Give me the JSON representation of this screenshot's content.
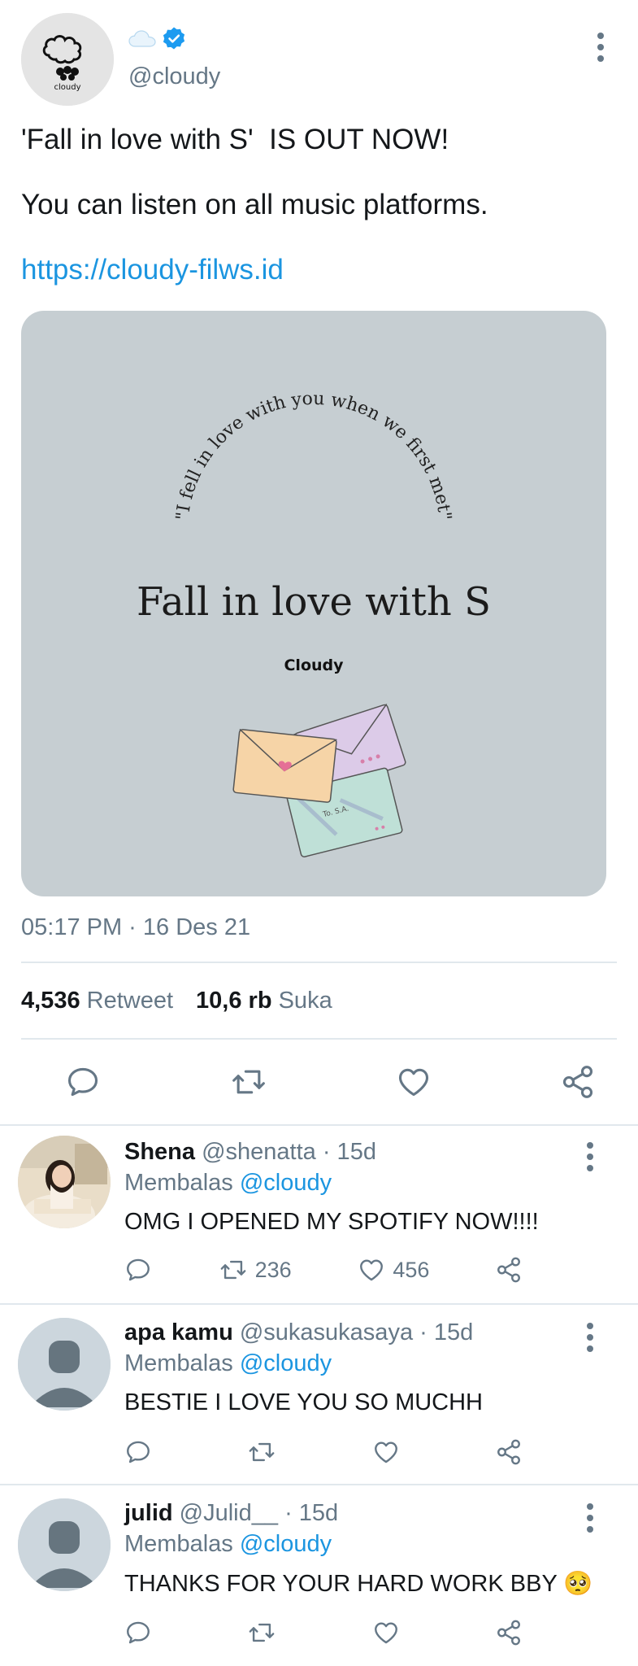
{
  "tweet": {
    "display_name_emoji": "☁️",
    "verified": true,
    "handle": "@cloudy",
    "avatar_text": "cloudy",
    "line1": "'Fall in love with S'  IS OUT NOW!",
    "line2": "You can listen on all music platforms.",
    "link": "https://cloudy-filws.id",
    "media": {
      "arc_text": "\"I fell in love with you when we first met\"",
      "title": "Fall in love with S",
      "artist": "Cloudy",
      "letter_text": "To. S.A."
    },
    "timestamp": "05:17 PM · 16 Des 21",
    "retweets_count": "4,536",
    "retweets_label": "Retweet",
    "likes_count": "10,6 rb",
    "likes_label": "Suka"
  },
  "replies": [
    {
      "name": "Shena",
      "meta": "@shenatta · 15d",
      "replying_prefix": "Membalas",
      "replying_to": "@cloudy",
      "text": "OMG I OPENED MY SPOTIFY NOW!!!!",
      "retweets": "236",
      "likes": "456"
    },
    {
      "name": "apa kamu",
      "meta": "@sukasukasaya · 15d",
      "replying_prefix": "Membalas",
      "replying_to": "@cloudy",
      "text": "BESTIE I LOVE YOU SO MUCHH",
      "retweets": "",
      "likes": ""
    },
    {
      "name": "julid",
      "meta": "@Julid__ · 15d",
      "replying_prefix": "Membalas",
      "replying_to": "@cloudy",
      "text": "THANKS FOR YOUR HARD WORK BBY 🥺",
      "retweets": "",
      "likes": ""
    }
  ],
  "icons": {
    "reply": "reply-icon",
    "retweet": "retweet-icon",
    "like": "heart-icon",
    "share": "share-icon",
    "more": "more-vertical-icon",
    "verified": "verified-badge-icon"
  },
  "colors": {
    "accent": "#1b95e0",
    "secondary_text": "#657786",
    "divider": "#e1e8ed",
    "media_background": "#c6ced2"
  }
}
